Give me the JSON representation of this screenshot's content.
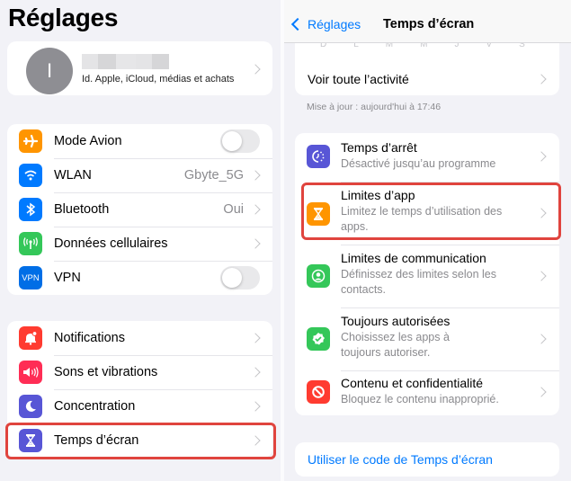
{
  "left": {
    "title": "Réglages",
    "account": {
      "initial": "I",
      "subtitle": "Id. Apple, iCloud, médias et achats"
    },
    "group1": [
      {
        "label": "Mode Avion",
        "icon": "airplane-icon",
        "color": "#ff9500",
        "toggle": false
      },
      {
        "label": "WLAN",
        "icon": "wifi-icon",
        "color": "#007aff",
        "value": "Gbyte_5G"
      },
      {
        "label": "Bluetooth",
        "icon": "bluetooth-icon",
        "color": "#007aff",
        "value": "Oui"
      },
      {
        "label": "Données cellulaires",
        "icon": "cellular-icon",
        "color": "#34c759"
      },
      {
        "label": "VPN",
        "icon": "vpn-icon",
        "color": "#006ee6",
        "toggle": false,
        "glyph": "VPN"
      }
    ],
    "group2": [
      {
        "label": "Notifications",
        "icon": "bell-icon",
        "color": "#ff3b30"
      },
      {
        "label": "Sons et vibrations",
        "icon": "speaker-icon",
        "color": "#ff2d55"
      },
      {
        "label": "Concentration",
        "icon": "moon-icon",
        "color": "#5856d6"
      },
      {
        "label": "Temps d’écran",
        "icon": "hourglass-icon",
        "color": "#5856d6",
        "highlighted": true
      }
    ]
  },
  "right": {
    "nav": {
      "back_label": "Réglages",
      "title": "Temps d’écran"
    },
    "days": [
      "D",
      "L",
      "M",
      "M",
      "J",
      "V",
      "S"
    ],
    "see_all": "Voir toute l’activité",
    "updated": "Mise à jour : aujourd'hui à 17:46",
    "items": [
      {
        "title": "Temps d’arrêt",
        "subtitle": "Désactivé jusqu’au programme",
        "icon": "downtime-icon",
        "color": "#5856d6"
      },
      {
        "title": "Limites d’app",
        "subtitle": "Limitez le temps d’utilisation des apps.",
        "icon": "hourglass-icon",
        "color": "#ff9500",
        "highlighted": true
      },
      {
        "title": "Limites de communication",
        "subtitle": "Définissez des limites selon les contacts.",
        "icon": "person-circle-icon",
        "color": "#34c759"
      },
      {
        "title": "Toujours autorisées",
        "subtitle": "Choisissez les apps à toujours autoriser.",
        "icon": "checkmark-seal-icon",
        "color": "#34c759"
      },
      {
        "title": "Contenu et confidentialité",
        "subtitle": "Bloquez le contenu inapproprié.",
        "icon": "restricted-icon",
        "color": "#ff3b30"
      }
    ],
    "passcode_link": "Utiliser le code de Temps d’écran"
  },
  "colors": {
    "accent": "#007aff",
    "highlight": "#e0443e",
    "background": "#f2f2f7"
  }
}
